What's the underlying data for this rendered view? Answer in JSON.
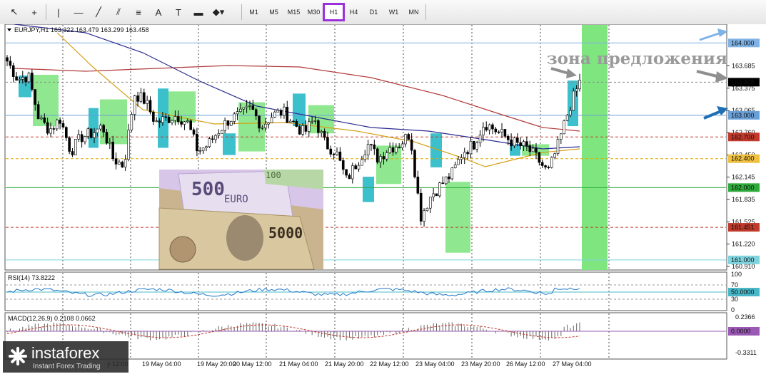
{
  "toolbar": {
    "tools": [
      {
        "name": "cursor-icon",
        "glyph": "↖"
      },
      {
        "name": "crosshair-icon",
        "glyph": "+"
      },
      {
        "name": "vertical-line-icon",
        "glyph": "|"
      },
      {
        "name": "horizontal-line-icon",
        "glyph": "—"
      },
      {
        "name": "trendline-icon",
        "glyph": "╱"
      },
      {
        "name": "channel-icon",
        "glyph": "⫽"
      },
      {
        "name": "fibonacci-icon",
        "glyph": "≡"
      },
      {
        "name": "text-icon",
        "glyph": "A"
      },
      {
        "name": "text-label-icon",
        "glyph": "T"
      },
      {
        "name": "rectangle-label-icon",
        "glyph": "▬"
      },
      {
        "name": "shapes-icon",
        "glyph": "◆▾"
      }
    ],
    "timeframes": [
      "M1",
      "M5",
      "M15",
      "M30",
      "H1",
      "H4",
      "D1",
      "W1",
      "MN"
    ],
    "active_timeframe": "H1"
  },
  "chart_header": {
    "symbol": "EURJPY,H1",
    "ohlc": "163.322 163.479 163.299 163.458"
  },
  "annotation": "зона предложения",
  "price_labels": [
    {
      "text": "164.000",
      "bg": "#7fb2e5",
      "fg": "#ffffff"
    },
    {
      "text": "163.458",
      "bg": "#000000",
      "fg": "#ffffff"
    },
    {
      "text": "163.000",
      "bg": "#6aa0d8",
      "fg": "#ffffff"
    },
    {
      "text": "162.700",
      "bg": "#c0392b",
      "fg": "#ffffff"
    },
    {
      "text": "162.400",
      "bg": "#f0c040",
      "fg": "#ffffff"
    },
    {
      "text": "162.000",
      "bg": "#2eaa3a",
      "fg": "#ffffff"
    },
    {
      "text": "161.451",
      "bg": "#c0392b",
      "fg": "#ffffff"
    },
    {
      "text": "161.000",
      "bg": "#7fd3df",
      "fg": "#ffffff"
    }
  ],
  "price_ticks": [
    "163.685",
    "163.375",
    "163.065",
    "162.760",
    "162.450",
    "162.145",
    "161.835",
    "161.525",
    "161.220",
    "160.910"
  ],
  "rsi": {
    "label": "RSI(14) 73.8222",
    "ticks": [
      "100",
      "70",
      "30",
      "0"
    ],
    "level_label": "50.0000"
  },
  "macd": {
    "label": "MACD(12,26,9) 0.2108 0.0662",
    "ticks": [
      "0.2366",
      "-0.3311"
    ],
    "level_label": "0.0000"
  },
  "time_labels": [
    "19 May 04:00",
    "19 May 20:00",
    "20 May 12:00",
    "21 May 04:00",
    "21 May 20:00",
    "22 May 12:00",
    "23 May 04:00",
    "23 May 20:00",
    "26 May 12:00",
    "27 May 04:00"
  ],
  "truncated_time_label": "y 12:00",
  "watermark": {
    "brand": "instaforex",
    "tagline": "Instant Forex Trading"
  },
  "chart_data": {
    "type": "candlestick",
    "symbol": "EURJPY",
    "timeframe": "H1",
    "ohlc_last": {
      "open": 163.322,
      "high": 163.479,
      "low": 163.299,
      "close": 163.458
    },
    "ylim": [
      160.91,
      164.2
    ],
    "x": [
      "18 May 12:00",
      "19 May 04:00",
      "19 May 20:00",
      "20 May 12:00",
      "21 May 04:00",
      "21 May 20:00",
      "22 May 12:00",
      "23 May 04:00",
      "23 May 20:00",
      "26 May 12:00",
      "27 May 04:00"
    ],
    "close_path": [
      163.75,
      163.5,
      163.55,
      162.95,
      162.8,
      162.95,
      162.5,
      162.7,
      162.75,
      162.85,
      162.4,
      162.3,
      163.3,
      163.2,
      162.9,
      162.95,
      163.0,
      162.9,
      162.5,
      162.6,
      162.8,
      162.95,
      163.0,
      163.1,
      162.85,
      163.0,
      163.05,
      162.9,
      162.75,
      162.95,
      162.6,
      162.5,
      162.1,
      162.35,
      162.6,
      162.4,
      162.55,
      162.6,
      162.75,
      161.6,
      161.9,
      162.05,
      162.2,
      162.5,
      162.6,
      162.9,
      162.8,
      162.7,
      162.6,
      162.55,
      162.4,
      162.2,
      162.6,
      163.1,
      163.46
    ],
    "levels": [
      {
        "price": 164.0,
        "color": "#7fb2e5",
        "style": "solid"
      },
      {
        "price": 163.0,
        "color": "#6aa0d8",
        "style": "solid"
      },
      {
        "price": 162.7,
        "color": "#c0392b",
        "style": "dashed"
      },
      {
        "price": 162.4,
        "color": "#e0a800",
        "style": "dashed"
      },
      {
        "price": 162.0,
        "color": "#2eaa3a",
        "style": "solid"
      },
      {
        "price": 161.451,
        "color": "#c0392b",
        "style": "dashed"
      },
      {
        "price": 161.0,
        "color": "#7fd3df",
        "style": "solid"
      }
    ],
    "rsi": {
      "period": 14,
      "value": 73.8222,
      "ylim": [
        0,
        100
      ],
      "levels": [
        70,
        50,
        30
      ]
    },
    "macd": {
      "fast": 12,
      "slow": 26,
      "signal": 9,
      "main": 0.2108,
      "signal_value": 0.0662,
      "ylim": [
        -0.3311,
        0.2366
      ]
    }
  }
}
